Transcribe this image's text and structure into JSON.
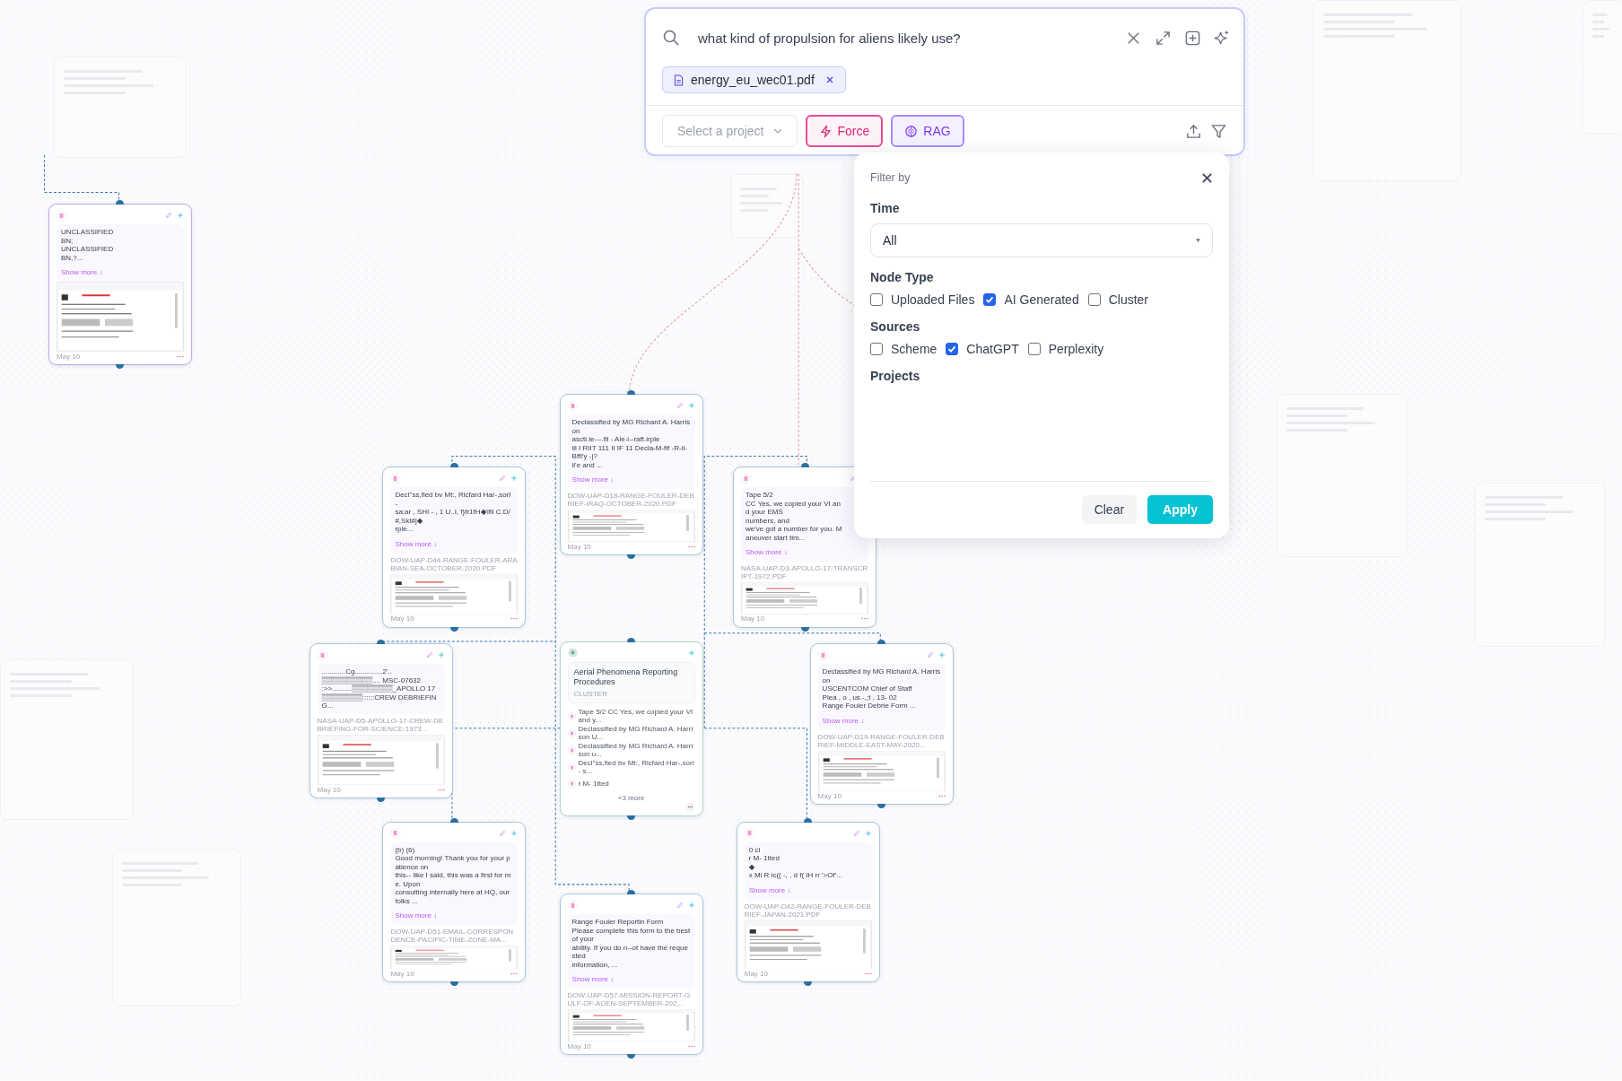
{
  "search": {
    "query": "what kind of propulsion for aliens likely use?",
    "attachment": "energy_eu_wec01.pdf",
    "project_select": {
      "placeholder": "Select a project"
    },
    "modes": [
      {
        "label": "Force",
        "kind": "force"
      },
      {
        "label": "RAG",
        "kind": "rag"
      }
    ]
  },
  "filter": {
    "title": "Filter by",
    "sections": [
      {
        "heading": "Time",
        "kind": "select",
        "value": "All"
      },
      {
        "heading": "Node Type",
        "kind": "checkboxes",
        "options": [
          {
            "label": "Uploaded Files",
            "checked": false
          },
          {
            "label": "AI Generated",
            "checked": true
          },
          {
            "label": "Cluster",
            "checked": false
          }
        ]
      },
      {
        "heading": "Sources",
        "kind": "checkboxes",
        "options": [
          {
            "label": "Scheme",
            "checked": false
          },
          {
            "label": "ChatGPT",
            "checked": true
          },
          {
            "label": "Perplexity",
            "checked": false
          }
        ]
      },
      {
        "heading": "Projects",
        "kind": "empty"
      }
    ],
    "buttons": [
      {
        "label": "Clear",
        "kind": "secondary"
      },
      {
        "label": "Apply",
        "kind": "primary"
      }
    ]
  },
  "nodes": [
    {
      "kind": "document",
      "selected": true,
      "lines": [
        "UNCLASSIFIED",
        "BN;",
        "UNCLASSIFIED",
        "BN,?..."
      ],
      "show_more": "Show more ↓",
      "date": "May 10"
    },
    {
      "kind": "document",
      "selected": false,
      "lines": [
        "Declassified by MG Richard A. Harrison",
        "ascti.le---.fil - Ale-i--raft.irple",
        "ill I RIIT 111 II IF 11 Decla-M-flf -R-ii-Bffl'y -|?",
        "ii'e and ..."
      ],
      "show_more": "Show more ↓",
      "file": "DOW-UAP-D18-RANGE-FOULER-DEBRIEF-IRAQ-OCTOBER-2020.PDF",
      "date": "May 10"
    },
    {
      "kind": "document",
      "selected": false,
      "lines": [
        "Decl''ss,fied bv Mt:, Ricfard Har-,sorI",
        "-",
        "sa:ar , SHI - , 1 U..I, f}fr1fH◆'ifli C.D/#,Skt#j◆",
        "rple..."
      ],
      "show_more": "Show more ↓",
      "file": "DOW-UAP-D44-RANGE-FOULER-ARABIAN-SEA-OCTOBER-2020.PDF",
      "date": "May 10"
    },
    {
      "kind": "document",
      "selected": false,
      "lines": [
        "Tape 5/2",
        "CC Yes, we copied your VI and your EMS",
        "numbers, and",
        "we've got a number for you. Maneuver start tim..."
      ],
      "show_more": "Show more ↓",
      "file": "NASA-UAP-D3-APOLLO-17-TRANSCRIPT-1972.PDF",
      "date": "May 10"
    },
    {
      "kind": "document",
      "selected": false,
      "lines": [
        "............Cg..............2'..",
        "▒▒▒▒▒▒▒▒▒▒.... MSC-07632",
        ":>>..........▒▒▒▒▒▒▒▒_APOLLO 17",
        "▒▒▒▒▒▒▒▒::::::CREW DEBRIEFING..."
      ],
      "file": "NASA-UAP-D5-APOLLO-17-CREW-DEBRIEFING-FOR-SCIENCE-1973...",
      "date": "May 10"
    },
    {
      "kind": "cluster",
      "title": "Aerial Phenomena Reporting Procedures",
      "label": "CLUSTER",
      "items": [
        "Tape 5/2 CC Yes, we copied your VI and y...",
        "Declassified by MG Richard A. Harrison U...",
        "Declassified by MG Richard A. Harrison u...",
        "Decl''ss,fied bv Mt:, Ricfard Har-,sorI - s...",
        "r M- 1tted"
      ],
      "more": "+3 more"
    },
    {
      "kind": "document",
      "selected": false,
      "lines": [
        "Declassified by MG Richard A. Harrison",
        "USCENTCOM Chief of Staff",
        "Plea , o , us.-,;t , 13- 02",
        "Range Fouler Debrie Form ..."
      ],
      "show_more": "Show more ↓",
      "file": "DOW-UAP-D19-RANGE-FOULER-DEBRIEF-MIDDLE-EAST-MAY-2020...",
      "date": "May 10"
    },
    {
      "kind": "document",
      "selected": false,
      "lines": [
        "(b) (6)",
        "Good morning! Thank you for your patience on",
        "this-- like I said, this was a first for me. Upon",
        "consulting internally here at HQ, our folks ..."
      ],
      "show_more": "Show more ↓",
      "file": "DOW-UAP-D51-EMAIL-CORRESPONDENCE-PACIFIC-TIME-ZONE-MA...",
      "date": "May 10"
    },
    {
      "kind": "document",
      "selected": false,
      "lines": [
        "Range Fouler Reportin Form",
        "Please complete this form to the best of your",
        "ability. If you do n--ot have the requested",
        "information, ..."
      ],
      "show_more": "Show more ↓",
      "file": "DOW-UAP-D57-MISSION-REPORT-GULF-OF-ADEN-SEPTEMBER-202...",
      "date": "May 10"
    },
    {
      "kind": "document",
      "selected": false,
      "lines": [
        "0 cl",
        "r M- 1tted",
        "◆",
        "x Ml R ic(( -, , d f( IH rr '>Of'..."
      ],
      "show_more": "Show more ↓",
      "file": "DOW-UAP-D42-RANGE-FOULER-DEBRIEF-JAPAN-2021.PDF",
      "date": "May 10"
    }
  ]
}
